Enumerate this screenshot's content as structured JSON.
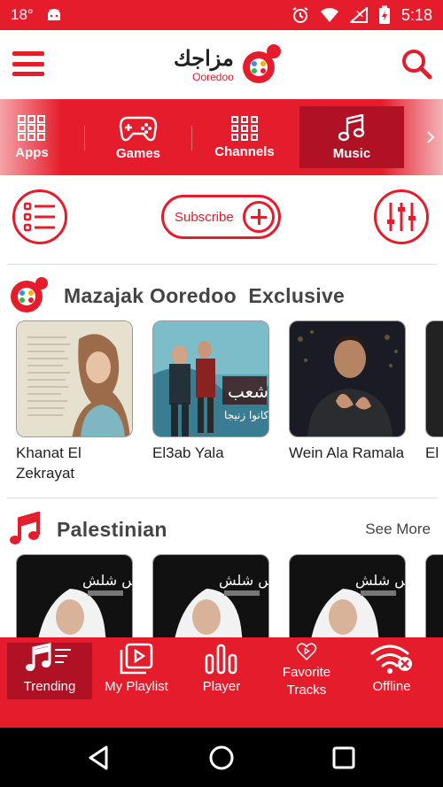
{
  "status_bar": {
    "notif_count": "18°",
    "time": "5:18"
  },
  "app": {
    "logo_ar": "مزاجك",
    "logo_en": "Ooredoo"
  },
  "categories": [
    {
      "label": "Apps",
      "icon": "grid-icon"
    },
    {
      "label": "Games",
      "icon": "gamepad-icon"
    },
    {
      "label": "Channels",
      "icon": "grid-icon"
    },
    {
      "label": "Music",
      "icon": "music-note-icon",
      "active": true
    }
  ],
  "actions": {
    "subscribe_label": "Subscribe"
  },
  "sections": [
    {
      "title": "Mazajak Ooredoo  Exclusive",
      "items": [
        {
          "title": "Khanat El Zekrayat"
        },
        {
          "title": "El3ab Yala"
        },
        {
          "title": "Wein Ala Ramala"
        },
        {
          "title": "El"
        }
      ]
    },
    {
      "title": "Palestinian",
      "see_more": "See More",
      "items": [
        {
          "overlay": "ميس شلش"
        },
        {
          "overlay": "ميس شلش"
        },
        {
          "overlay": "ميس شلش"
        }
      ]
    }
  ],
  "cover_text": {
    "el3ab_overlay": "شعب",
    "el3ab_sub": "اركانوا زنيجا"
  },
  "bottom_nav": [
    {
      "label": "Trending",
      "active": true
    },
    {
      "label": "My Playlist"
    },
    {
      "label": "Player"
    },
    {
      "label": "Favorite Tracks"
    },
    {
      "label": "Offline"
    }
  ],
  "colors": {
    "primary": "#e51c2b",
    "primary_dark": "#b01124"
  }
}
